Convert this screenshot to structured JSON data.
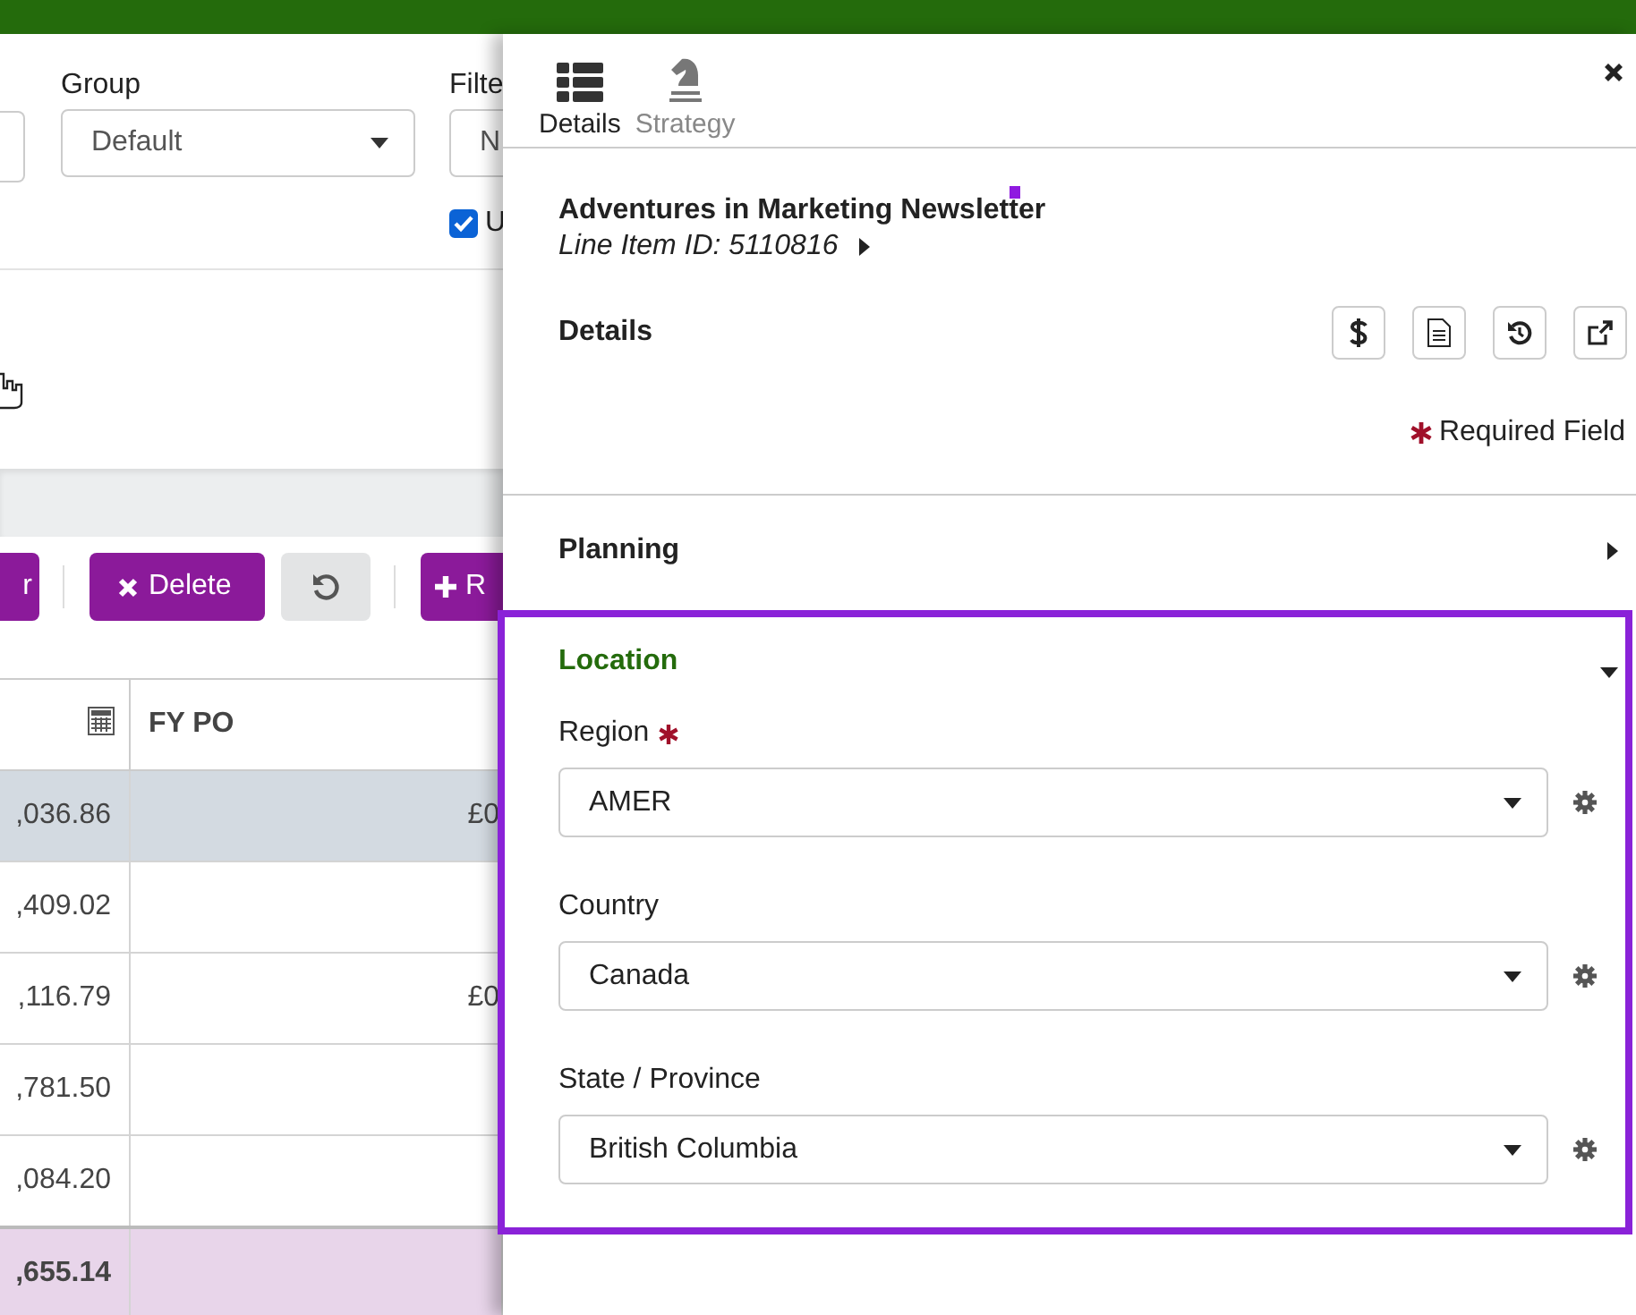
{
  "filters": [
    {
      "label": "Group",
      "value": "Default"
    },
    {
      "label": "Filte",
      "value": "N"
    }
  ],
  "filter_checkbox": {
    "label": "U",
    "checked": true
  },
  "toolbar": [
    {
      "kind": "cut",
      "label": "r"
    },
    {
      "kind": "delete",
      "label": "Delete"
    },
    {
      "kind": "reset"
    },
    {
      "kind": "add",
      "label": "R"
    }
  ],
  "table": {
    "columns": [
      {
        "kind": "calc"
      },
      {
        "kind": "text",
        "label": "FY PO"
      }
    ],
    "rows": [
      {
        "kind": "data",
        "selected": true,
        "cells": [
          ",036.86",
          "£0"
        ]
      },
      {
        "kind": "data",
        "selected": false,
        "cells": [
          ",409.02"
        ]
      },
      {
        "kind": "data",
        "selected": false,
        "cells": [
          ",116.79",
          "£0"
        ]
      },
      {
        "kind": "data",
        "selected": false,
        "cells": [
          ",781.50"
        ]
      },
      {
        "kind": "data",
        "selected": false,
        "cells": [
          ",084.20"
        ]
      },
      {
        "kind": "total",
        "selected": false,
        "cells": [
          ",655.14"
        ]
      }
    ]
  },
  "panel": {
    "tabs": [
      {
        "label": "Details",
        "selected": true
      },
      {
        "label": "Strategy",
        "selected": false
      }
    ],
    "title": "Adventures in Marketing Newsletter",
    "subtitle": "Line Item ID: 5110816",
    "details_heading": "Details",
    "required_note": "Required Field",
    "sections": [
      {
        "title": "Planning",
        "expanded": false
      },
      {
        "title": "Location",
        "expanded": true,
        "fields": [
          {
            "label": "Region",
            "required": true,
            "value": "AMER"
          },
          {
            "label": "Country",
            "required": false,
            "value": "Canada"
          },
          {
            "label": "State / Province",
            "required": false,
            "value": "British Columbia"
          }
        ]
      }
    ]
  }
}
